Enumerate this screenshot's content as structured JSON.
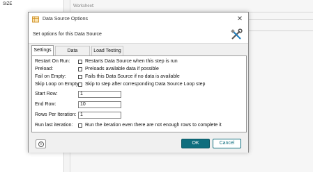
{
  "background": {
    "left_column_header": "SIZE",
    "worksheet_label": "Worksheet:"
  },
  "dialog": {
    "title": "Data Source Options",
    "subtitle": "Set options for this Data Source",
    "close_glyph": "✕",
    "tabs": [
      {
        "label": "Settings",
        "active": true
      },
      {
        "label": "Data Processing",
        "active": false
      },
      {
        "label": "Load Testing",
        "active": false
      }
    ],
    "settings": {
      "restart_on_run": {
        "label": "Restart On Run:",
        "text": "Restarts Data Source when this step is run",
        "checked": false
      },
      "preload": {
        "label": "Preload:",
        "text": "Preloads available data if possible",
        "checked": false
      },
      "fail_on_empty": {
        "label": "Fail on Empty:",
        "text": "Fails this Data Source if no data is available",
        "checked": false
      },
      "skip_loop_on_empty": {
        "label": "Skip Loop on Empty:",
        "text": "Skip to step after corresponding Data Source Loop step",
        "checked": false
      },
      "start_row": {
        "label": "Start Row:",
        "value": "1"
      },
      "end_row": {
        "label": "End Row:",
        "value": "10"
      },
      "rows_per_iteration": {
        "label": "Rows Per Iteration:",
        "value": "1"
      },
      "run_last_iteration": {
        "label": "Run last iteration:",
        "text": "Run the iteration even there are not enough rows to complete it",
        "checked": false
      }
    },
    "footer": {
      "info_glyph": "i",
      "ok_label": "OK",
      "cancel_label": "Cancel"
    },
    "colors": {
      "accent": "#0f6e7e",
      "title_icon_orange": "#e8a020"
    }
  }
}
